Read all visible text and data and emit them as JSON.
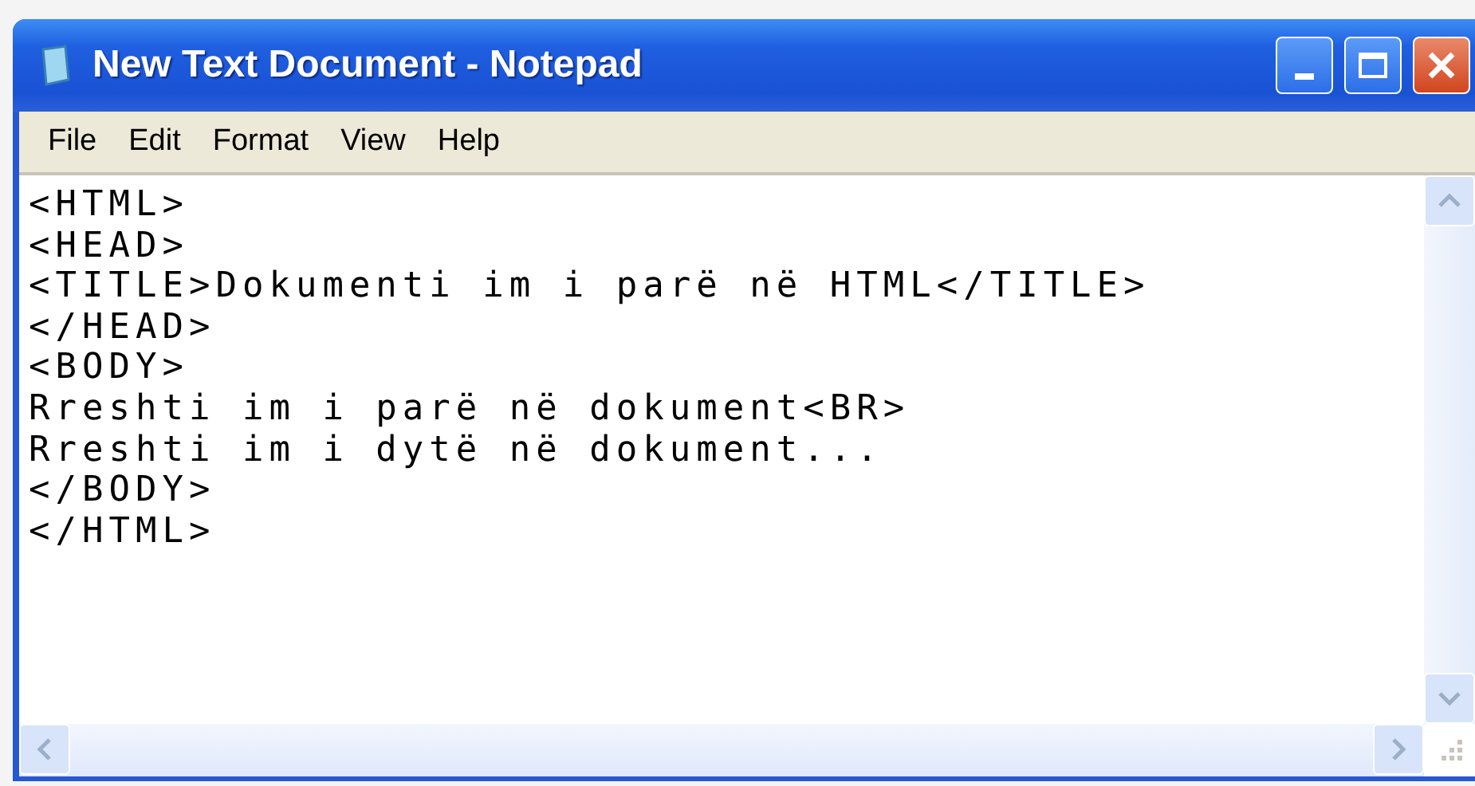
{
  "window": {
    "title": "New Text Document - Notepad"
  },
  "menu": [
    "File",
    "Edit",
    "Format",
    "View",
    "Help"
  ],
  "editor": {
    "lines": [
      "<HTML>",
      "<HEAD>",
      "<TITLE>Dokumenti im i parë në HTML</TITLE>",
      "</HEAD>",
      "<BODY>",
      "Rreshti im i parë në dokument<BR>",
      "Rreshti im i dytë në dokument...",
      "</BODY>",
      "</HTML>"
    ]
  }
}
